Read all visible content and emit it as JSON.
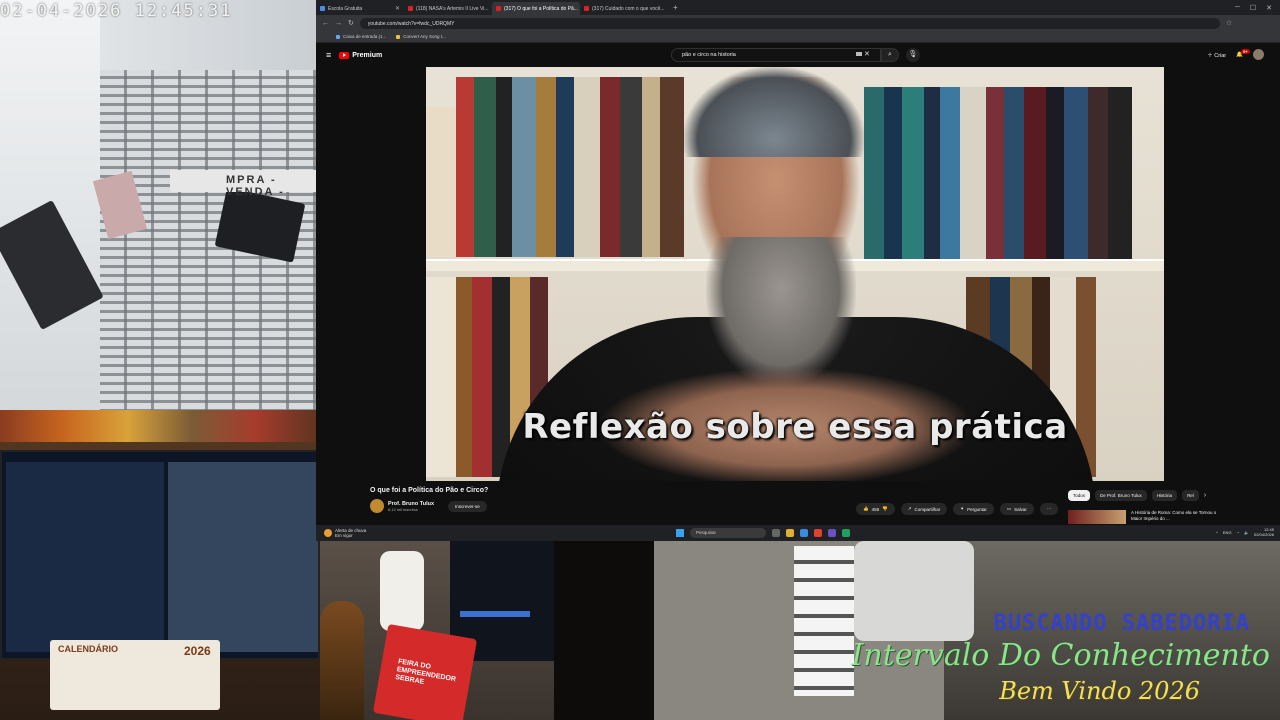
{
  "camera_left": {
    "timestamp": "02-04-2026  12:45:31",
    "sign_text": "MPRA - VENDA -"
  },
  "camera_desk": {
    "calendar_title": "CALENDÁRIO",
    "calendar_year": "2026"
  },
  "browser": {
    "tabs": [
      {
        "label": "Escola Gratuita",
        "active": false
      },
      {
        "label": "(118) NASA's Artemis II Live Vi...",
        "active": false
      },
      {
        "label": "(317) O que foi a Política do Pã...",
        "active": true
      },
      {
        "label": "(317) Cuidado com o que você...",
        "active": false
      }
    ],
    "url": "youtube.com/watch?v=fwdc_UDRQMY",
    "bookmarks": [
      "Caixa de entrada (1...",
      "Convert Any Song t..."
    ]
  },
  "youtube": {
    "logo_text": "Premium",
    "search_value": "pão e circo na historia",
    "create_label": "Criar",
    "notification_count": "9+",
    "caption": "Reflexão sobre essa prática",
    "video_title": "O que foi a Política do Pão e Circo?",
    "channel_name": "Prof. Bruno Tulux",
    "channel_subs": "6,12 mil inscritos",
    "subscribe_label": "Inscrever-se",
    "likes": "459",
    "share_label": "Compartilhar",
    "ask_label": "Perguntar",
    "save_label": "Salvar",
    "chips": [
      "Todos",
      "De Prof. Bruno Tulux",
      "História",
      "Rel"
    ],
    "rec_title": "A História de Roma: Como ela se Tornou o Maior Império do ..."
  },
  "taskbar": {
    "weather_title": "Alerta de chuva",
    "weather_sub": "Em vigor",
    "search_placeholder": "Pesquisar",
    "lang": "ENG",
    "time": "12:45",
    "date": "02/04/2026"
  },
  "camera_mid": {
    "poster_text": "FEIRA DO EMPREENDEDOR SEBRAE"
  },
  "overlay": {
    "line1": "BUSCANDO SABEDORIA",
    "line2": "Intervalo Do Conhecimento",
    "line3": "Bem Vindo 2026"
  }
}
